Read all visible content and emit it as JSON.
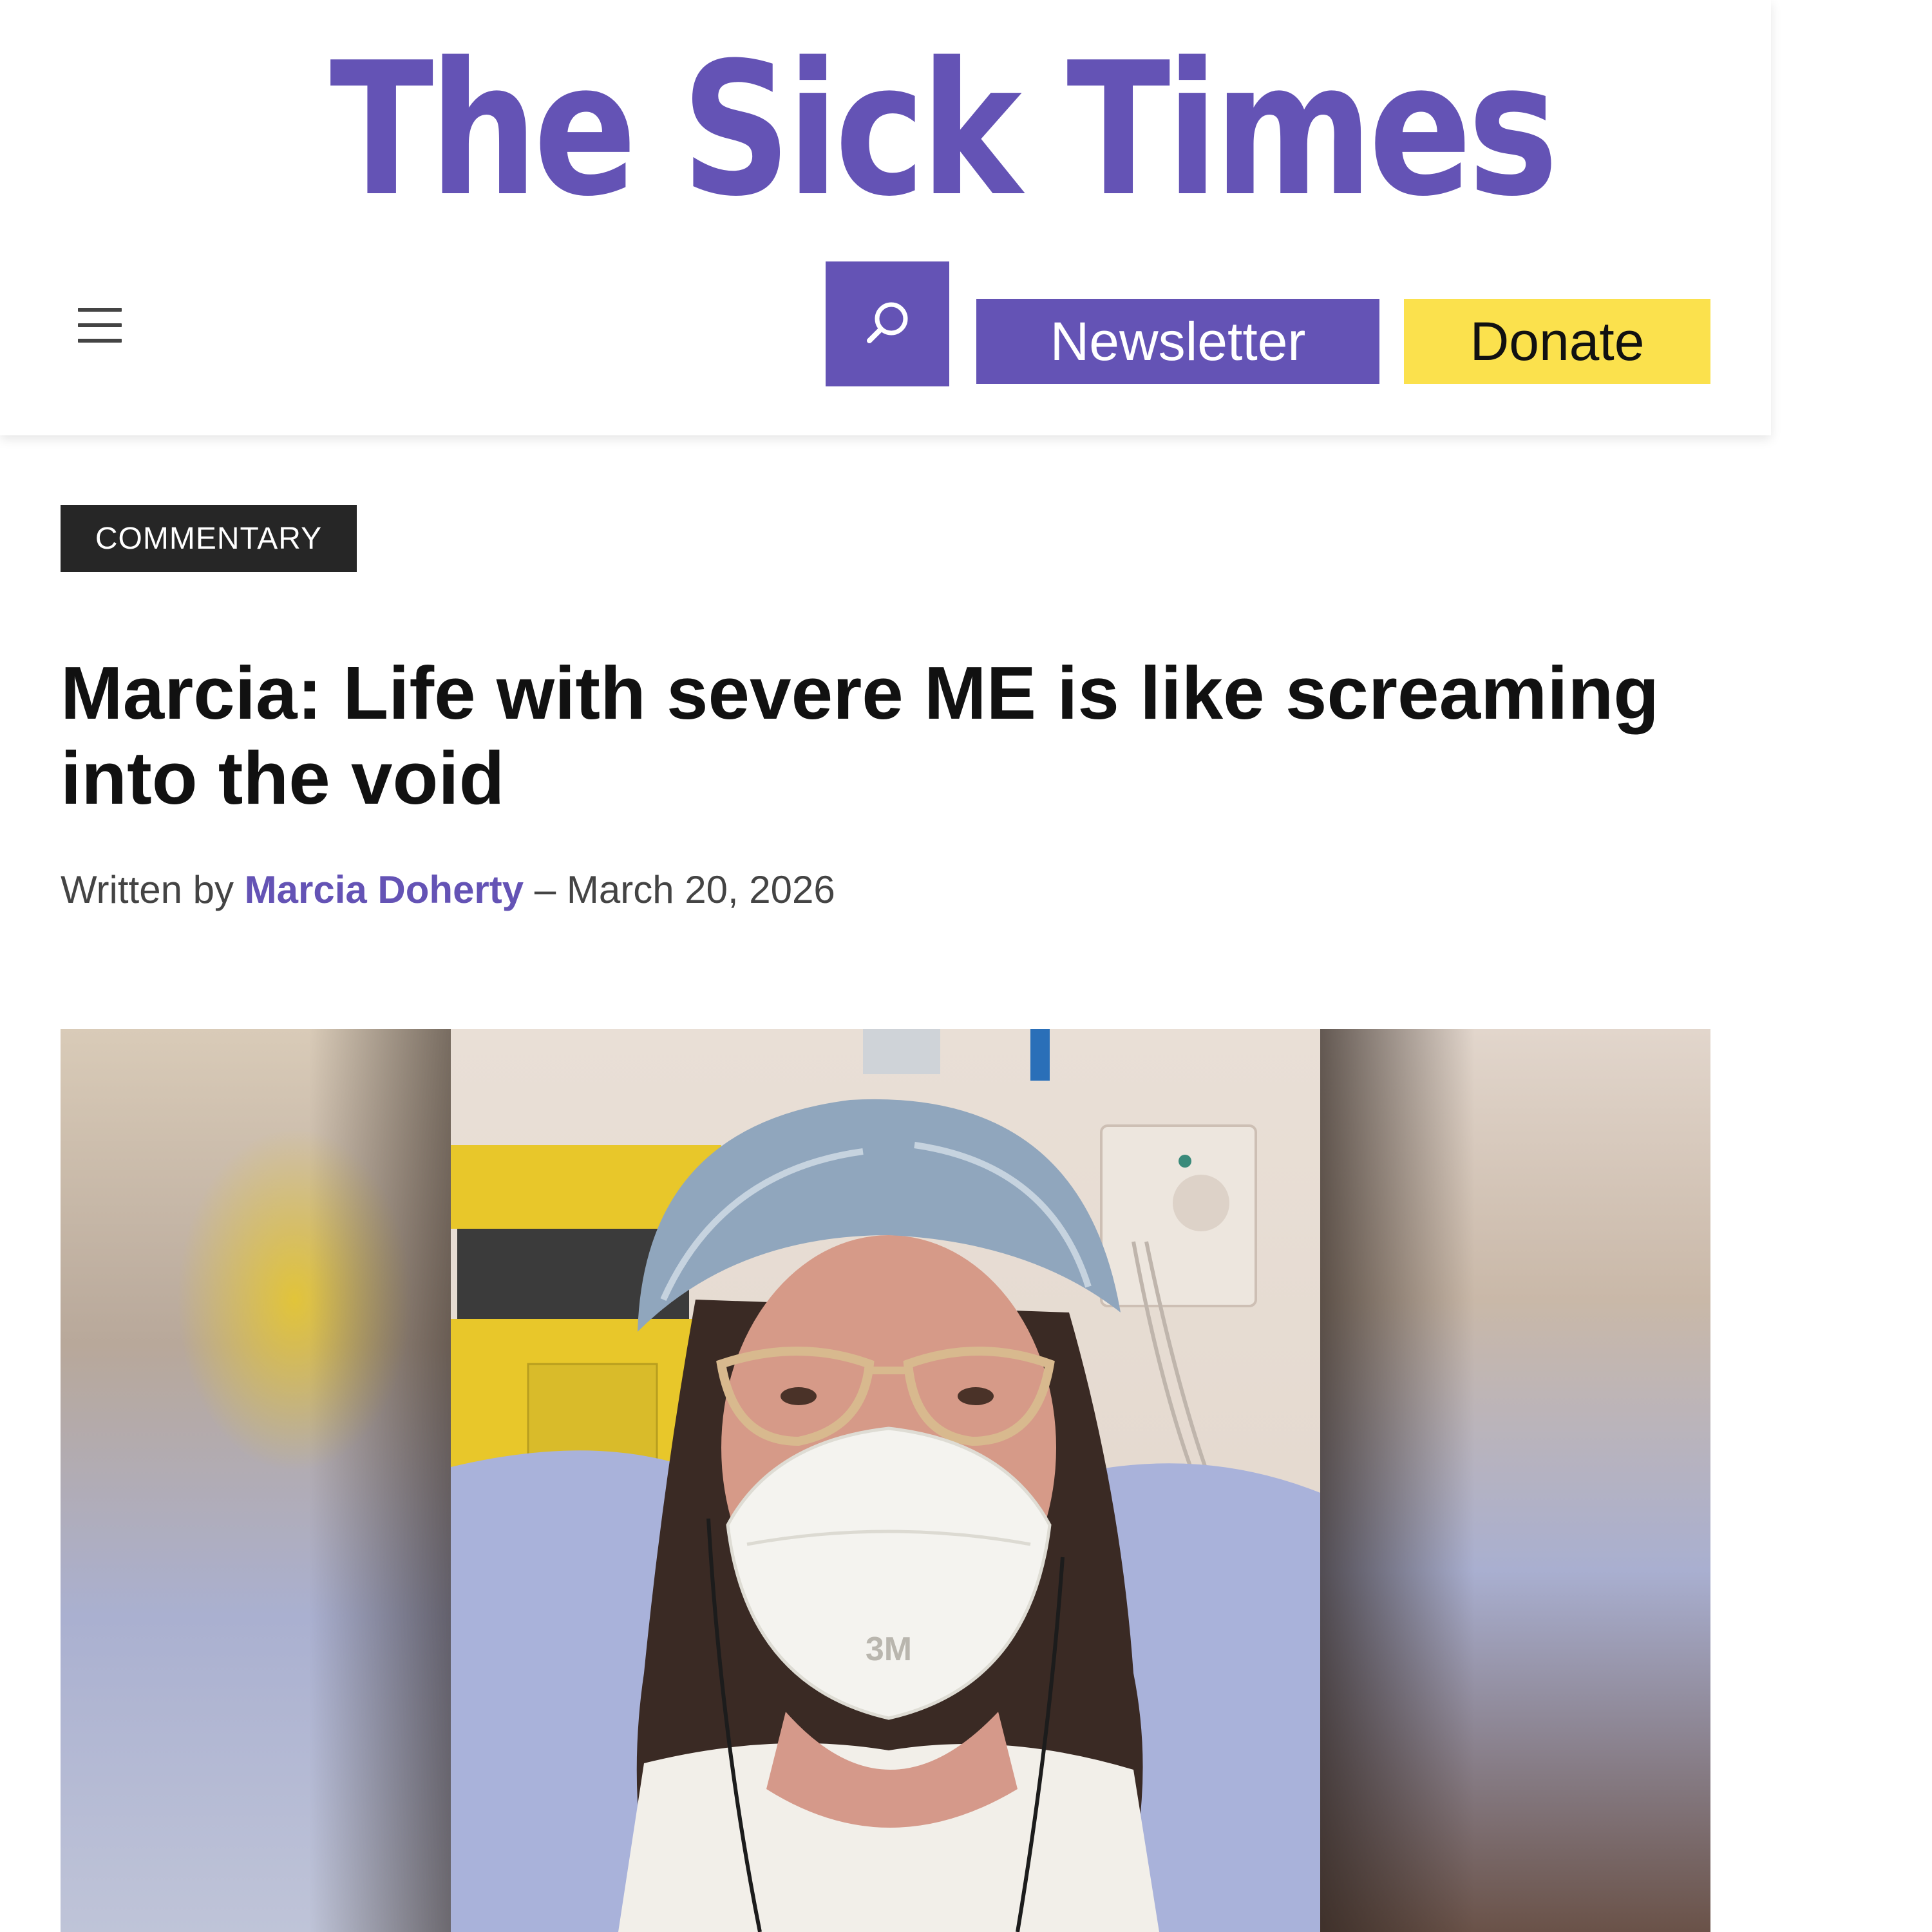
{
  "colors": {
    "brand_purple": "#6453b5",
    "donate_yellow": "#fbe14d",
    "badge_dark": "#262626",
    "text_dark": "#111111",
    "byline_gray": "#444444"
  },
  "header": {
    "logo_text": "The Sick Times",
    "menu_icon": "hamburger-menu-icon",
    "search_icon": "search-icon",
    "newsletter_label": "Newsletter",
    "donate_label": "Donate"
  },
  "article": {
    "category": "COMMENTARY",
    "title": "Marcia: Life with severe ME is like screaming into the void",
    "byline": {
      "prefix": "Written by",
      "author": "Marcia Doherty",
      "separator": "–",
      "date": "March 20, 2026"
    },
    "image": {
      "mask_text": "3M"
    }
  }
}
